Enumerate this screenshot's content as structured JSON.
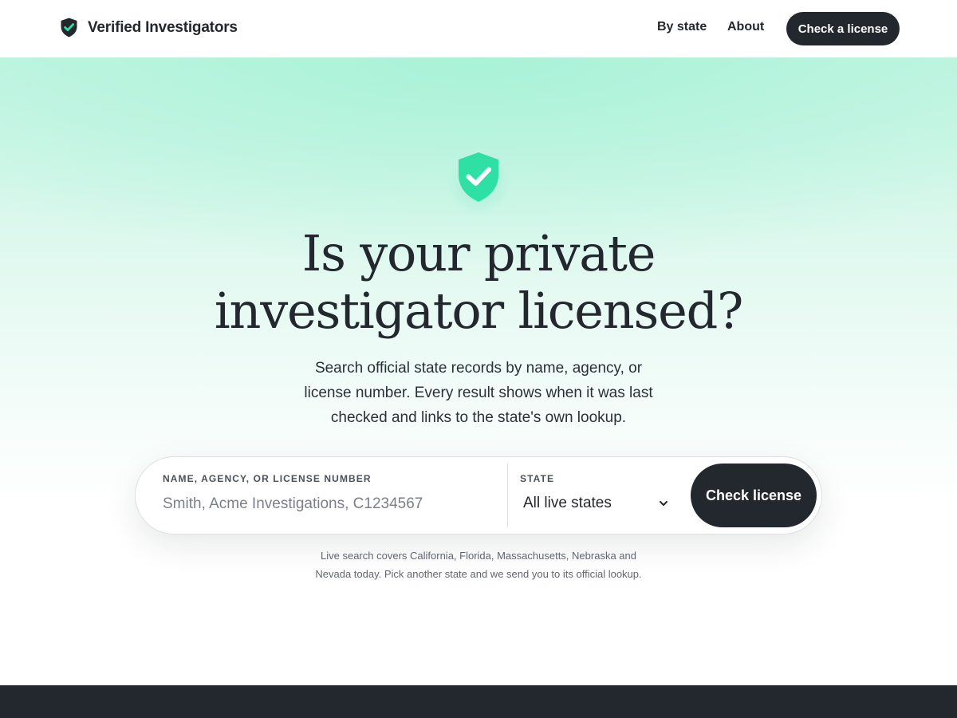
{
  "header": {
    "brand_name": "Verified Investigators",
    "brand_icon": "shield-check-icon",
    "nav": [
      {
        "label": "By state"
      },
      {
        "label": "About"
      }
    ],
    "cta_label": "Check a license",
    "colors": {
      "dark": "#23272e",
      "accent": "#2fe0a5"
    }
  },
  "hero": {
    "icon": "shield-check-icon",
    "title": "Is your private investigator licensed?",
    "subtitle": "Search official state records by name, agency, or license number. Every result shows when it was last checked and links to the state's own lookup."
  },
  "search": {
    "query_label": "NAME, AGENCY, OR LICENSE NUMBER",
    "query_placeholder": "Smith, Acme Investigations, C1234567",
    "query_value": "",
    "state_label": "STATE",
    "state_selected": "All live states",
    "submit_label": "Check license"
  },
  "coverage_note": "Live search covers California, Florida, Massachusetts, Nebraska and Nevada today. Pick another state and we send you to its official lookup."
}
